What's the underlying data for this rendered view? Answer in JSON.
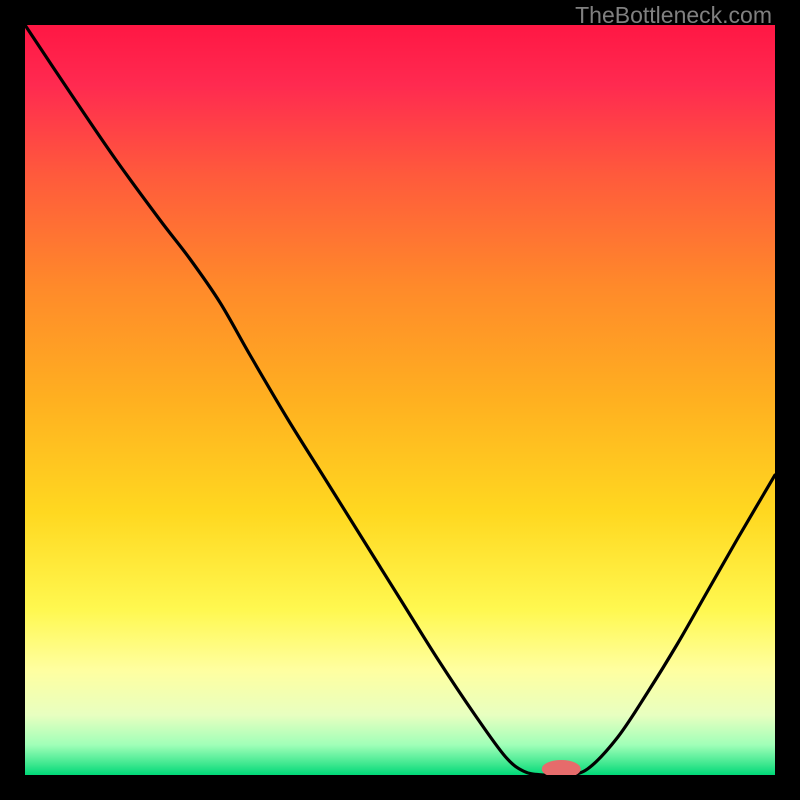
{
  "watermark": "TheBottleneck.com",
  "chart_data": {
    "type": "line",
    "title": "",
    "xlabel": "",
    "ylabel": "",
    "gradient_stops": [
      {
        "pos": 0.0,
        "color": "#FF1744"
      },
      {
        "pos": 0.08,
        "color": "#FF2A50"
      },
      {
        "pos": 0.2,
        "color": "#FF5A3C"
      },
      {
        "pos": 0.35,
        "color": "#FF8A2A"
      },
      {
        "pos": 0.5,
        "color": "#FFB020"
      },
      {
        "pos": 0.65,
        "color": "#FFD820"
      },
      {
        "pos": 0.78,
        "color": "#FFF850"
      },
      {
        "pos": 0.86,
        "color": "#FFFFA0"
      },
      {
        "pos": 0.92,
        "color": "#E8FFC0"
      },
      {
        "pos": 0.96,
        "color": "#A0FFB8"
      },
      {
        "pos": 0.985,
        "color": "#40E890"
      },
      {
        "pos": 1.0,
        "color": "#00D878"
      }
    ],
    "curve_points": [
      {
        "x": 0.0,
        "y": 1.0
      },
      {
        "x": 0.06,
        "y": 0.91
      },
      {
        "x": 0.12,
        "y": 0.822
      },
      {
        "x": 0.18,
        "y": 0.74
      },
      {
        "x": 0.22,
        "y": 0.688
      },
      {
        "x": 0.26,
        "y": 0.63
      },
      {
        "x": 0.3,
        "y": 0.56
      },
      {
        "x": 0.35,
        "y": 0.475
      },
      {
        "x": 0.4,
        "y": 0.395
      },
      {
        "x": 0.45,
        "y": 0.315
      },
      {
        "x": 0.5,
        "y": 0.235
      },
      {
        "x": 0.55,
        "y": 0.155
      },
      {
        "x": 0.6,
        "y": 0.08
      },
      {
        "x": 0.64,
        "y": 0.025
      },
      {
        "x": 0.665,
        "y": 0.005
      },
      {
        "x": 0.69,
        "y": 0.0
      },
      {
        "x": 0.72,
        "y": 0.0
      },
      {
        "x": 0.75,
        "y": 0.008
      },
      {
        "x": 0.79,
        "y": 0.05
      },
      {
        "x": 0.83,
        "y": 0.11
      },
      {
        "x": 0.87,
        "y": 0.175
      },
      {
        "x": 0.91,
        "y": 0.245
      },
      {
        "x": 0.95,
        "y": 0.315
      },
      {
        "x": 1.0,
        "y": 0.4
      }
    ],
    "marker": {
      "x": 0.715,
      "y": 0.0,
      "rx": 0.026,
      "ry": 0.012,
      "color": "#E66B6B"
    },
    "xlim": [
      0,
      1
    ],
    "ylim": [
      0,
      1
    ]
  }
}
